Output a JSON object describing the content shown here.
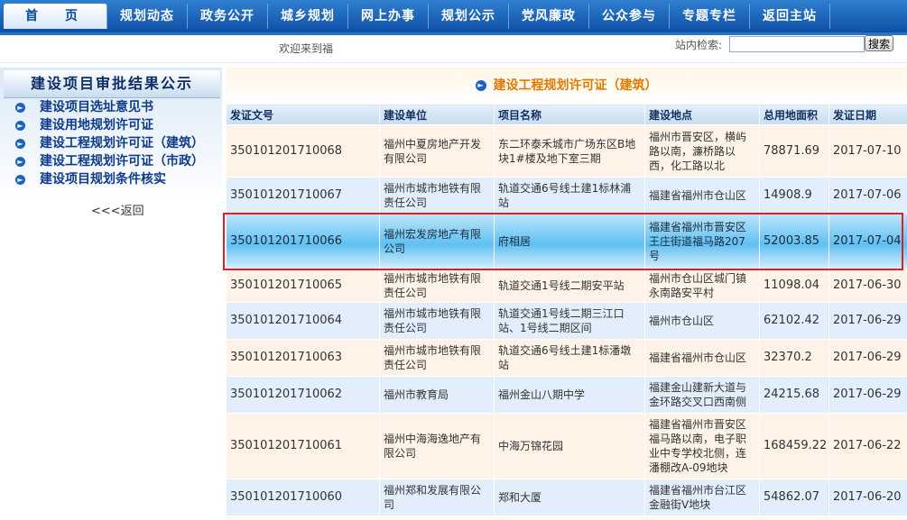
{
  "nav": {
    "items": [
      "首　页",
      "规划动态",
      "政务公开",
      "城乡规划",
      "网上办事",
      "规划公示",
      "党风廉政",
      "公众参与",
      "专题专栏",
      "返回主站"
    ]
  },
  "subbar": {
    "welcome": "欢迎来到福",
    "search_label": "站内检索:",
    "search_value": "",
    "search_button": "搜索"
  },
  "sidebar": {
    "title": "建设项目审批结果公示",
    "links": [
      "建设项目选址意见书",
      "建设用地规划许可证",
      "建设工程规划许可证（建筑）",
      "建设工程规划许可证（市政）",
      "建设项目规划条件核实"
    ],
    "back": "<<<返回"
  },
  "main": {
    "title": "建设工程规划许可证（建筑）",
    "headers": [
      "发证文号",
      "建设单位",
      "项目名称",
      "建设地点",
      "总用地面积",
      "发证日期"
    ],
    "rows": [
      [
        "350101201710068",
        "福州中夏房地产开发有限公司",
        "东二环泰禾城市广场东区B地块1#楼及地下室三期",
        "福州市晋安区，横屿路以南，濂桥路以西，化工路以北",
        "78871.69",
        "2017-07-10"
      ],
      [
        "350101201710067",
        "福州市城市地铁有限责任公司",
        "轨道交通6号线土建1标林浦站",
        "福建省福州市仓山区",
        "14908.9",
        "2017-07-06"
      ],
      [
        "350101201710066",
        "福州宏发房地产有限公司",
        "府相居",
        "福建省福州市晋安区王庄街道福马路207号",
        "52003.85",
        "2017-07-04"
      ],
      [
        "350101201710065",
        "福州市城市地铁有限责任公司",
        "轨道交通1号线二期安平站",
        "福州市仓山区城门镇永南路安平村",
        "11098.04",
        "2017-06-30"
      ],
      [
        "350101201710064",
        "福州市城市地铁有限责任公司",
        "轨道交通1号线二期三江口站、1号线二期区间",
        "福州市仓山区",
        "62102.42",
        "2017-06-29"
      ],
      [
        "350101201710063",
        "福州市城市地铁有限责任公司",
        "轨道交通6号线土建1标潘墩站",
        "福建省福州市仓山区",
        "32370.2",
        "2017-06-29"
      ],
      [
        "350101201710062",
        "福州市教育局",
        "福州金山八期中学",
        "福建金山建新大道与金环路交叉口西南侧",
        "24215.68",
        "2017-06-29"
      ],
      [
        "350101201710061",
        "福州中海海逸地产有限公司",
        "中海万锦花园",
        "福建省福州市晋安区福马路以南，电子职业中专学校北侧，连潘棚改A-09地块",
        "168459.22",
        "2017-06-22"
      ],
      [
        "350101201710060",
        "福州郑和发展有限公司",
        "郑和大厦",
        "福建省福州市台江区金融街V地块",
        "54862.07",
        "2017-06-20"
      ]
    ]
  }
}
